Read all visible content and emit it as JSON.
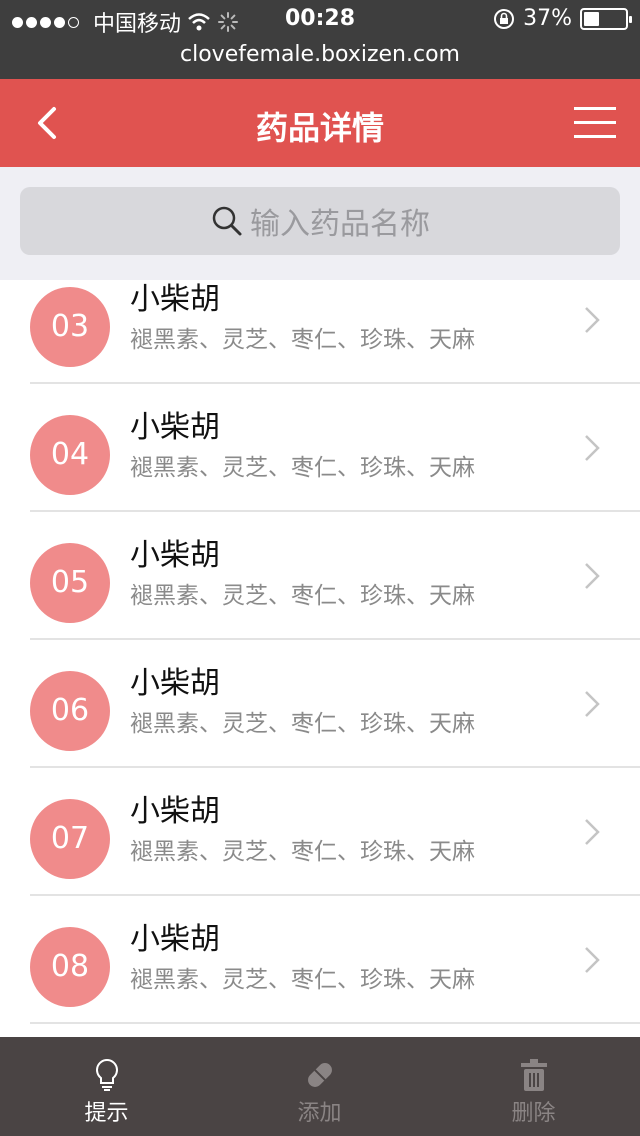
{
  "status_bar": {
    "carrier": "中国移动",
    "time": "00:28",
    "battery_text": "37%",
    "battery_level": 0.37
  },
  "url_bar": {
    "url": "clovefemale.boxizen.com"
  },
  "navbar": {
    "title": "药品详情",
    "back_icon": "chevron-left-icon",
    "menu_icon": "hamburger-menu-icon"
  },
  "search": {
    "placeholder": "输入药品名称",
    "icon": "search-icon"
  },
  "list": {
    "items": [
      {
        "number": "03",
        "name": "小柴胡",
        "ingredients": "褪黑素、灵芝、枣仁、珍珠、天麻"
      },
      {
        "number": "04",
        "name": "小柴胡",
        "ingredients": "褪黑素、灵芝、枣仁、珍珠、天麻"
      },
      {
        "number": "05",
        "name": "小柴胡",
        "ingredients": "褪黑素、灵芝、枣仁、珍珠、天麻"
      },
      {
        "number": "06",
        "name": "小柴胡",
        "ingredients": "褪黑素、灵芝、枣仁、珍珠、天麻"
      },
      {
        "number": "07",
        "name": "小柴胡",
        "ingredients": "褪黑素、灵芝、枣仁、珍珠、天麻"
      },
      {
        "number": "08",
        "name": "小柴胡",
        "ingredients": "褪黑素、灵芝、枣仁、珍珠、天麻"
      }
    ]
  },
  "tabbar": {
    "tabs": [
      {
        "label": "提示",
        "icon": "lightbulb-icon",
        "active": true
      },
      {
        "label": "添加",
        "icon": "pill-icon",
        "active": false
      },
      {
        "label": "删除",
        "icon": "trash-icon",
        "active": false
      }
    ]
  },
  "colors": {
    "accent": "#e05350",
    "badge": "#f08b8b",
    "tabbar": "#4a4444"
  }
}
